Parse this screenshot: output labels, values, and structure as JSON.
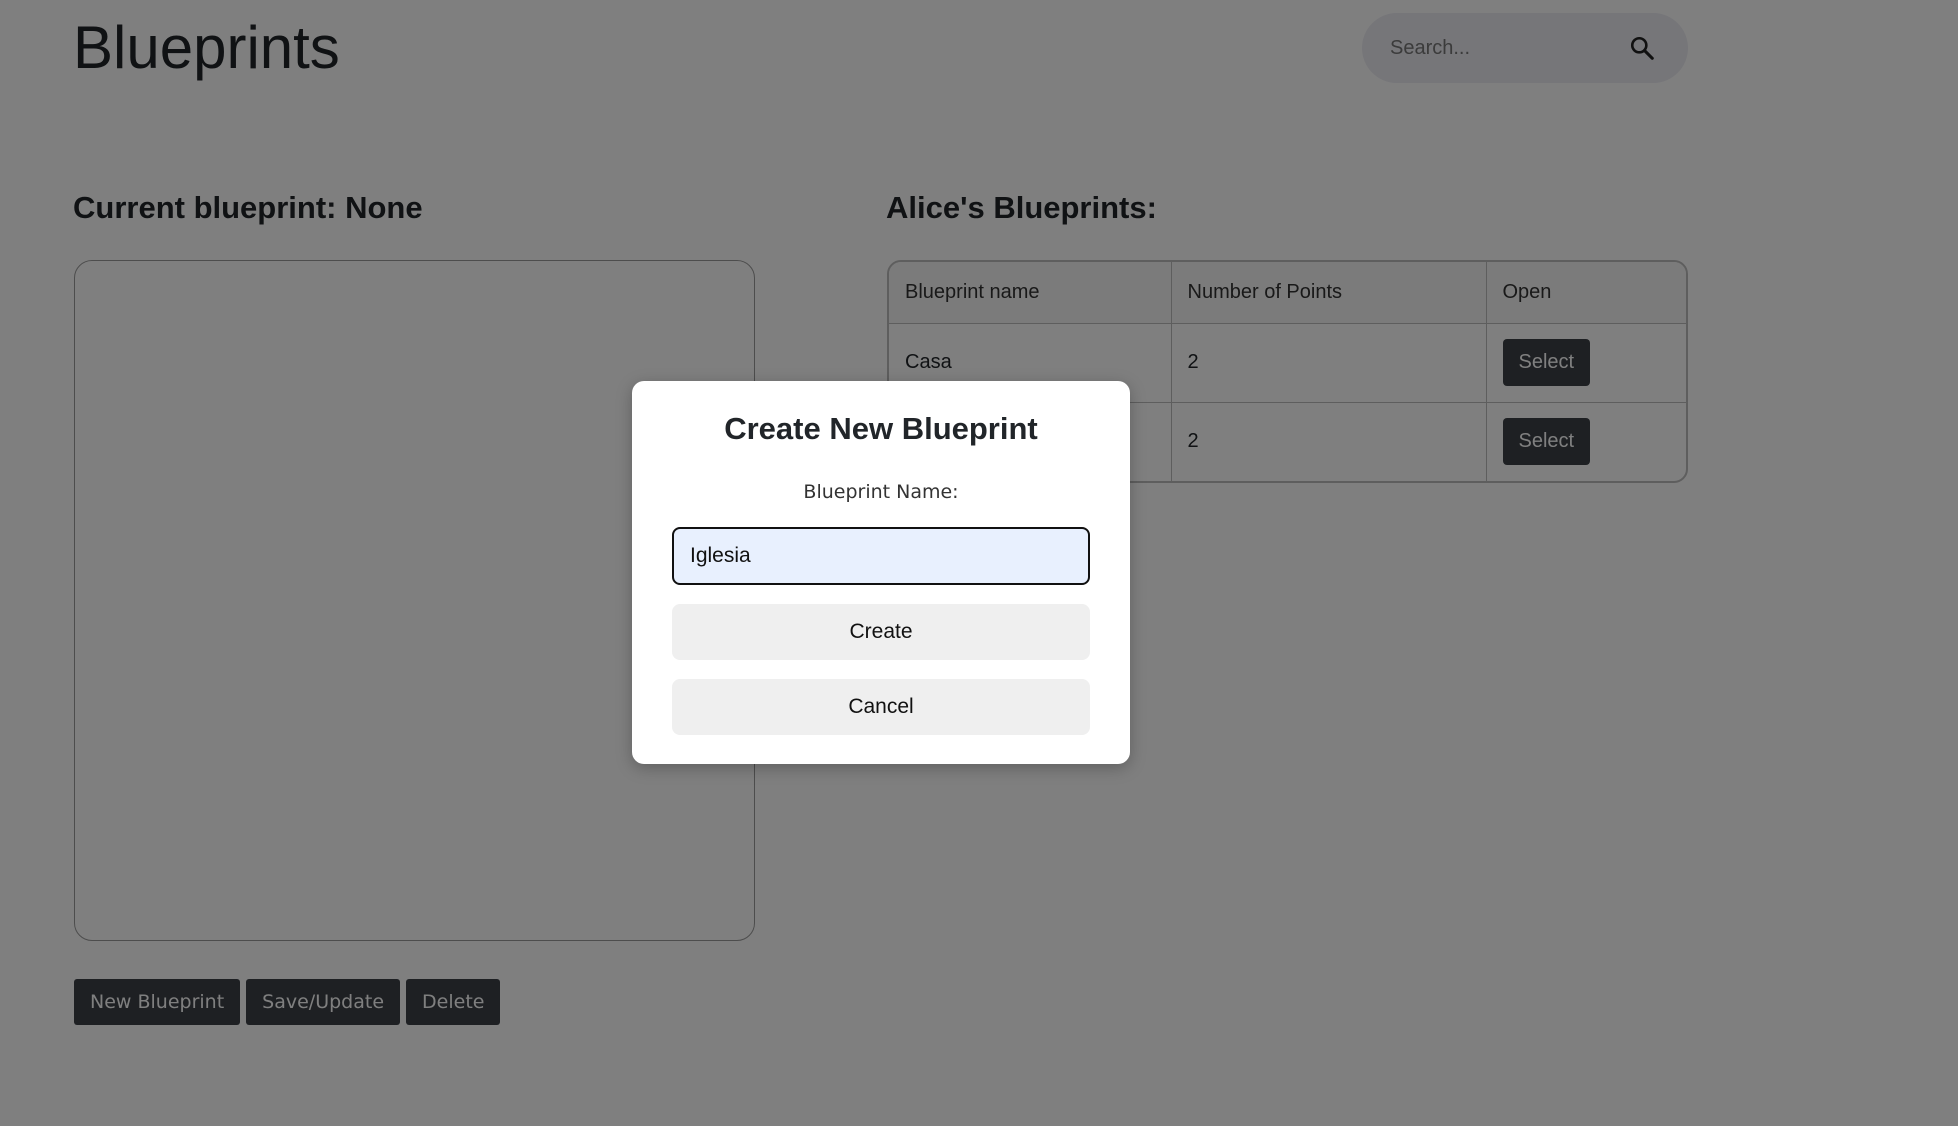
{
  "header": {
    "title": "Blueprints",
    "search_placeholder": "Search...",
    "search_icon": "search-icon"
  },
  "current": {
    "heading": "Current blueprint: None"
  },
  "list": {
    "heading": "Alice's Blueprints:",
    "columns": [
      "Blueprint name",
      "Number of Points",
      "Open"
    ],
    "rows": [
      {
        "name": "Casa",
        "points": "2",
        "action": "Select"
      },
      {
        "name": "",
        "points": "2",
        "action": "Select"
      }
    ]
  },
  "actions": {
    "new_label": "New Blueprint",
    "save_label": "Save/Update",
    "delete_label": "Delete"
  },
  "modal": {
    "title": "Create New Blueprint",
    "name_label": "Blueprint Name:",
    "name_value": "Iglesia",
    "create_label": "Create",
    "cancel_label": "Cancel"
  },
  "colors": {
    "overlay": "#808080",
    "dark_button": "#3c4147",
    "input_fill": "#e8f0fe"
  }
}
